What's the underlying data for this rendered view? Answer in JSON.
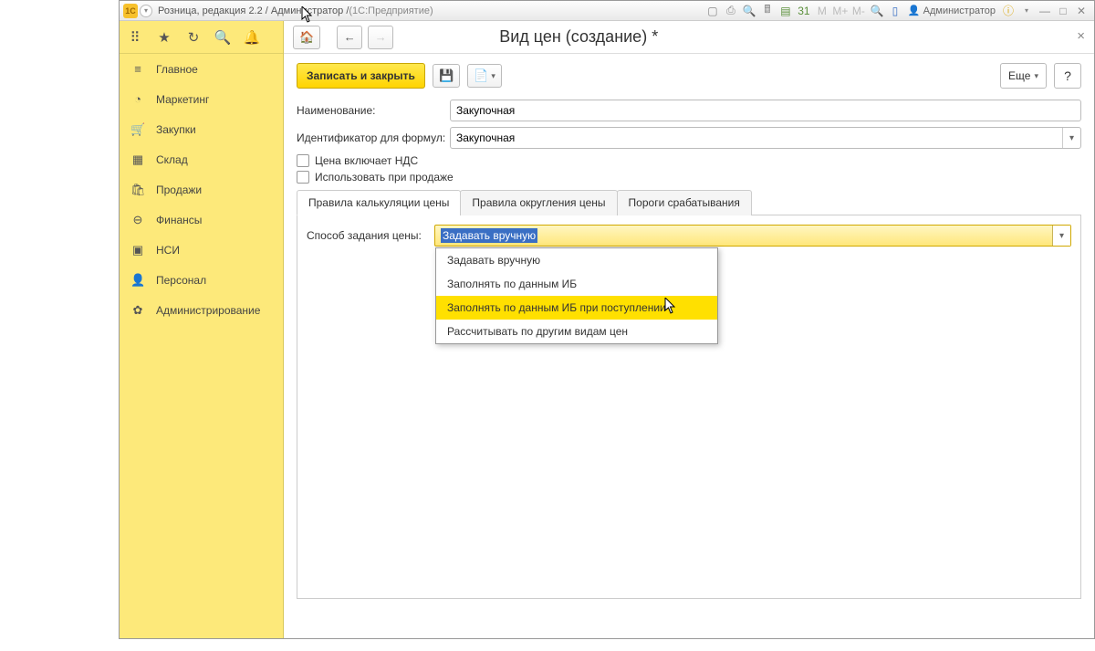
{
  "titlebar": {
    "logo_text": "1C",
    "title": "Розница, редакция 2.2 / Администратор / ",
    "path": "(1С:Предприятие)",
    "user": "Администратор",
    "m_lbls": [
      "M",
      "M+",
      "M-"
    ]
  },
  "sidebar": {
    "items": [
      {
        "icon": "≡",
        "label": "Главное"
      },
      {
        "icon": "◔",
        "label": "Маркетинг"
      },
      {
        "icon": "🛒",
        "label": "Закупки"
      },
      {
        "icon": "▦",
        "label": "Склад"
      },
      {
        "icon": "🛍",
        "label": "Продажи"
      },
      {
        "icon": "⊖",
        "label": "Финансы"
      },
      {
        "icon": "▣",
        "label": "НСИ"
      },
      {
        "icon": "👤",
        "label": "Персонал"
      },
      {
        "icon": "✿",
        "label": "Администрирование"
      }
    ]
  },
  "page": {
    "title": "Вид цен (создание) *"
  },
  "cmdbar": {
    "save_close": "Записать и закрыть",
    "more": "Еще",
    "help": "?"
  },
  "form": {
    "name_label": "Наименование:",
    "name_value": "Закупочная",
    "id_label": "Идентификатор для формул:",
    "id_value": "Закупочная",
    "chk_vat": "Цена включает НДС",
    "chk_sale": "Использовать при продаже"
  },
  "tabs": {
    "items": [
      {
        "label": "Правила калькуляции цены"
      },
      {
        "label": "Правила округления цены"
      },
      {
        "label": "Пороги срабатывания"
      }
    ]
  },
  "method": {
    "label": "Способ задания цены:",
    "selected": "Задавать вручную",
    "options": [
      "Задавать вручную",
      "Заполнять по данным ИБ",
      "Заполнять по данным ИБ при поступлении",
      "Рассчитывать по другим видам цен"
    ],
    "hover_index": 2
  }
}
